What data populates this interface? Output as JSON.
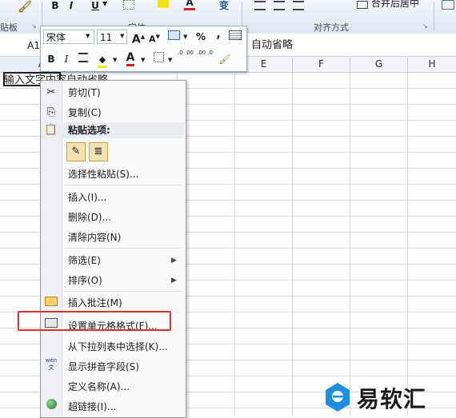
{
  "ribbon": {
    "clipboard_group": "贴板",
    "font_group": "字体",
    "align_group": "对齐方式",
    "merge_label": "合并后居中",
    "bold": "B",
    "underline": "U",
    "phonetic": "变"
  },
  "formula_bar": {
    "name_box": "A1",
    "content": "自动省略"
  },
  "columns": [
    "A",
    "E",
    "F",
    "G",
    "H"
  ],
  "cell_a1": "输入文字内容自动省略",
  "mini_toolbar": {
    "font": "宋体",
    "size": "11",
    "bold": "B",
    "italic": "I",
    "grow_font": "A",
    "shrink_font": "A",
    "percent": "%",
    "comma": ",",
    "font_color_letter": "A",
    "dec_increase": ".0 .00",
    "dec_decrease": ".00 .0"
  },
  "context_menu": {
    "cut": "剪切(T)",
    "copy": "复制(C)",
    "paste_options": "粘贴选项:",
    "paste_special": "选择性粘贴(S)...",
    "insert": "插入(I)...",
    "delete": "删除(D)...",
    "clear": "清除内容(N)",
    "filter": "筛选(E)",
    "sort": "排序(O)",
    "insert_comment": "插入批注(M)",
    "format_cells": "设置单元格格式(F)...",
    "pick_from_list": "从下拉列表中选择(K)...",
    "phonetic": "显示拼音字段(S)",
    "define_name": "定义名称(A)...",
    "hyperlink": "超链接(I)...",
    "phonetic_icon_text": "wén 文"
  },
  "watermark": {
    "text": "易软汇"
  },
  "colors": {
    "highlight": "#d9312c",
    "ribbon_bg": "#dde6f1",
    "font_color_red": "#d62020",
    "watermark_blue": "#1c8fe0"
  }
}
